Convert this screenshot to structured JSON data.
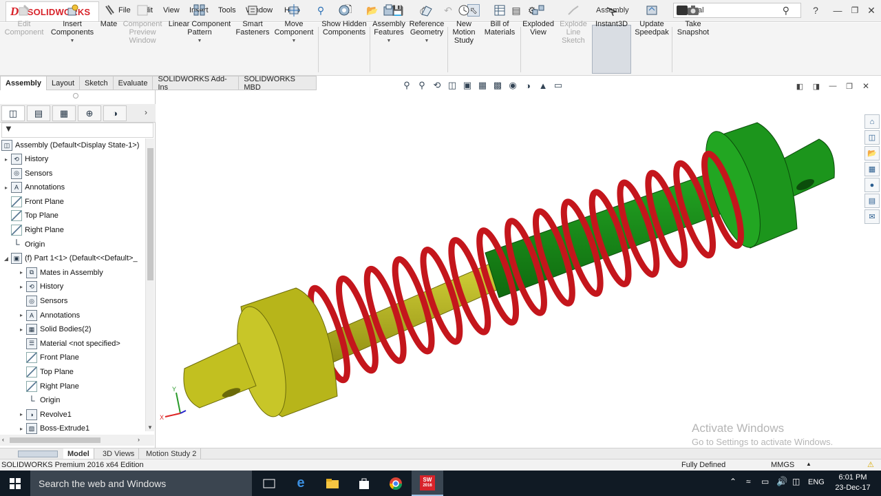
{
  "app": {
    "logo_ds": "DS",
    "logo_text": "SOLIDWORKS",
    "document_title": "Assembly"
  },
  "menu": [
    "File",
    "Edit",
    "View",
    "Insert",
    "Tools",
    "Window",
    "Help"
  ],
  "search": {
    "value": "scal"
  },
  "commands": [
    {
      "label": "Edit Component",
      "enabled": false,
      "icon": "edit-component-icon"
    },
    {
      "label": "Insert Components",
      "enabled": true,
      "icon": "insert-components-icon"
    },
    {
      "label": "Mate",
      "enabled": true,
      "icon": "paperclip-icon"
    },
    {
      "label": "Component Preview Window",
      "enabled": false,
      "icon": "preview-window-icon"
    },
    {
      "label": "Linear Component Pattern",
      "enabled": true,
      "icon": "pattern-icon"
    },
    {
      "label": "Smart Fasteners",
      "enabled": true,
      "icon": "fastener-icon"
    },
    {
      "label": "Move Component",
      "enabled": true,
      "icon": "move-component-icon"
    },
    {
      "label": "Show Hidden Components",
      "enabled": true,
      "icon": "show-hidden-icon"
    },
    {
      "label": "Assembly Features",
      "enabled": true,
      "icon": "assembly-features-icon"
    },
    {
      "label": "Reference Geometry",
      "enabled": true,
      "icon": "reference-geometry-icon"
    },
    {
      "label": "New Motion Study",
      "enabled": true,
      "icon": "motion-study-icon"
    },
    {
      "label": "Bill of Materials",
      "enabled": true,
      "icon": "bom-icon"
    },
    {
      "label": "Exploded View",
      "enabled": true,
      "icon": "exploded-view-icon"
    },
    {
      "label": "Explode Line Sketch",
      "enabled": false,
      "icon": "explode-line-icon"
    },
    {
      "label": "Instant3D",
      "enabled": true,
      "icon": "instant3d-icon"
    },
    {
      "label": "Update Speedpak",
      "enabled": true,
      "icon": "speedpak-icon"
    },
    {
      "label": "Take Snapshot",
      "enabled": true,
      "icon": "camera-icon"
    }
  ],
  "tabs": [
    "Assembly",
    "Layout",
    "Sketch",
    "Evaluate",
    "SOLIDWORKS Add-Ins",
    "SOLIDWORKS MBD"
  ],
  "tree": {
    "root": "Assembly  (Default<Display State-1>)",
    "items": [
      {
        "label": "History",
        "icon": "history"
      },
      {
        "label": "Sensors",
        "icon": "sensor"
      },
      {
        "label": "Annotations",
        "icon": "annotation"
      },
      {
        "label": "Front Plane",
        "icon": "plane"
      },
      {
        "label": "Top Plane",
        "icon": "plane"
      },
      {
        "label": "Right Plane",
        "icon": "plane"
      },
      {
        "label": "Origin",
        "icon": "origin"
      },
      {
        "label": "(f) Part 1<1> (Default<<Default>_",
        "icon": "part"
      },
      {
        "label": "Mates in Assembly",
        "icon": "mates"
      },
      {
        "label": "History",
        "icon": "history"
      },
      {
        "label": "Sensors",
        "icon": "sensor"
      },
      {
        "label": "Annotations",
        "icon": "annotation"
      },
      {
        "label": "Solid Bodies(2)",
        "icon": "solid"
      },
      {
        "label": "Material <not specified>",
        "icon": "material"
      },
      {
        "label": "Front Plane",
        "icon": "plane"
      },
      {
        "label": "Top Plane",
        "icon": "plane"
      },
      {
        "label": "Right Plane",
        "icon": "plane"
      },
      {
        "label": "Origin",
        "icon": "origin"
      },
      {
        "label": "Revolve1",
        "icon": "revolve"
      },
      {
        "label": "Boss-Extrude1",
        "icon": "extrude"
      }
    ]
  },
  "triad": {
    "x": "X",
    "y": "Y"
  },
  "bottom_tabs": [
    "Model",
    "3D Views",
    "Motion Study 2"
  ],
  "status": {
    "edition": "SOLIDWORKS Premium 2016 x64 Edition",
    "state": "Fully Defined",
    "units": "MMGS"
  },
  "watermark": {
    "line1": "Activate Windows",
    "line2": "Go to Settings to activate Windows."
  },
  "taskbar": {
    "search_placeholder": "Search the web and Windows",
    "language": "ENG",
    "time": "6:01 PM",
    "date": "23-Dec-17",
    "sw_badge": "2016"
  },
  "colors": {
    "spring": "#c4161c",
    "rod_green": "#1b8c1b",
    "rod_yellow": "#b8b61a",
    "accent": "#d8232a"
  }
}
